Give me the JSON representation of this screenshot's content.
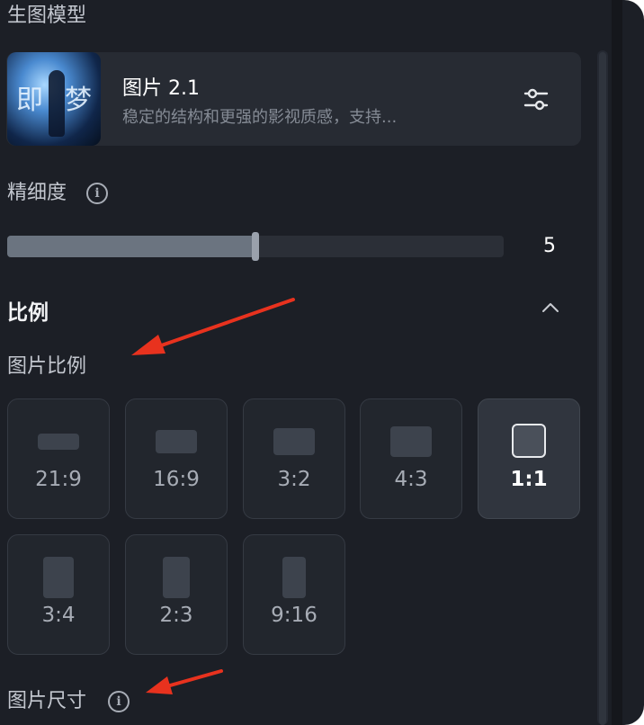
{
  "header": {
    "section_label": "生图模型"
  },
  "model": {
    "name": "图片 2.1",
    "description": "稳定的结构和更强的影视质感，支持...",
    "thumbnail_text_left": "即",
    "thumbnail_text_right": "梦",
    "settings_icon": "sliders-icon"
  },
  "detail": {
    "label": "精细度",
    "info_icon": "info-icon",
    "info_glyph": "i",
    "value": "5",
    "level_fraction": 0.5
  },
  "ratio": {
    "title": "比例",
    "collapse_icon": "chevron-up-icon",
    "image_ratio_label": "图片比例",
    "options": [
      {
        "label": "21:9",
        "selected": false
      },
      {
        "label": "16:9",
        "selected": false
      },
      {
        "label": "3:2",
        "selected": false
      },
      {
        "label": "4:3",
        "selected": false
      },
      {
        "label": "1:1",
        "selected": true
      },
      {
        "label": "3:4",
        "selected": false
      },
      {
        "label": "2:3",
        "selected": false
      },
      {
        "label": "9:16",
        "selected": false
      }
    ]
  },
  "size": {
    "label": "图片尺寸",
    "info_icon": "info-icon",
    "info_glyph": "i"
  },
  "colors": {
    "background": "#1c1f26",
    "card": "#272b33",
    "annotation_arrow": "#e8321e"
  }
}
